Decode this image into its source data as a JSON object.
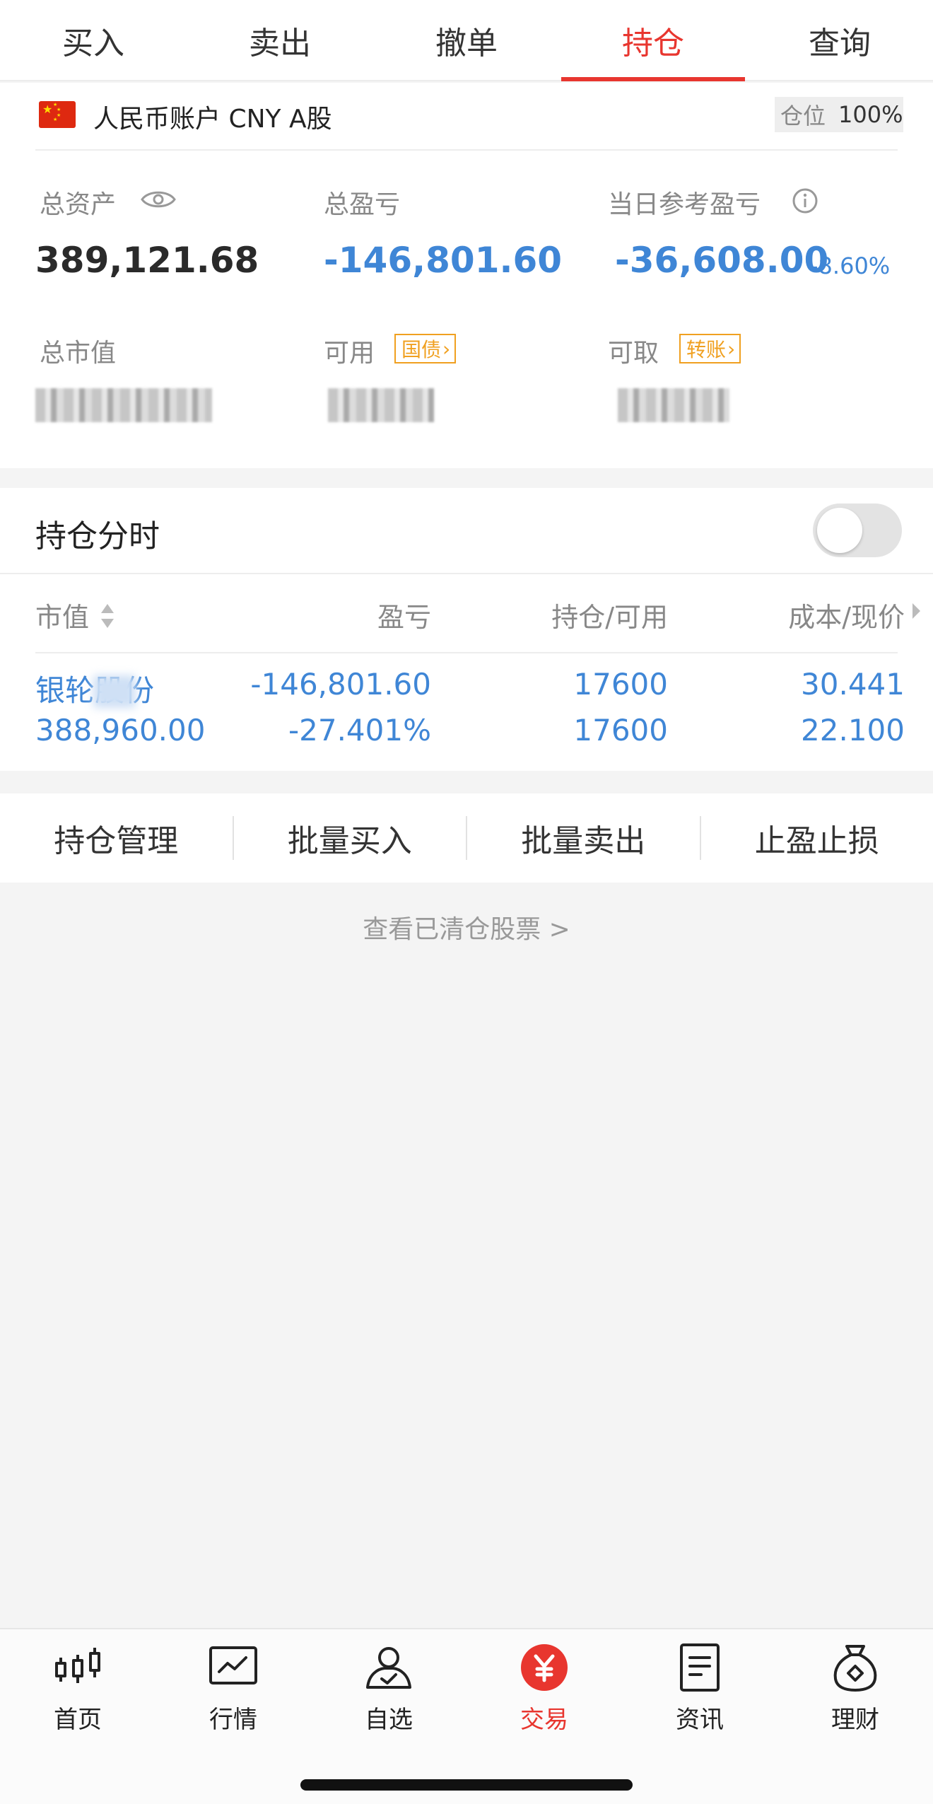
{
  "tabs": [
    {
      "label": "买入",
      "active": false
    },
    {
      "label": "卖出",
      "active": false
    },
    {
      "label": "撤单",
      "active": false
    },
    {
      "label": "持仓",
      "active": true
    },
    {
      "label": "查询",
      "active": false
    }
  ],
  "account": {
    "name": "人民币账户 CNY A股",
    "position_label": "仓位",
    "position_value": "100%",
    "total_assets_label": "总资产",
    "total_assets": "389,121.68",
    "total_pnl_label": "总盈亏",
    "total_pnl": "-146,801.60",
    "daily_pnl_label": "当日参考盈亏",
    "daily_pnl": "-36,608.00",
    "daily_pnl_pct": "-8.60%",
    "market_value_label": "总市值",
    "available_label": "可用",
    "available_tag": "国债",
    "withdrawable_label": "可取",
    "withdrawable_tag": "转账"
  },
  "holdings": {
    "title": "持仓分时",
    "toggle_on": false,
    "columns": [
      "市值",
      "盈亏",
      "持仓/可用",
      "成本/现价"
    ],
    "rows": [
      {
        "name": "银轮股份",
        "market_value": "388,960.00",
        "pnl": "-146,801.60",
        "pnl_pct": "-27.401%",
        "holding": "17600",
        "available": "17600",
        "cost": "30.441",
        "price": "22.100"
      }
    ]
  },
  "actions": [
    "持仓管理",
    "批量买入",
    "批量卖出",
    "止盈止损"
  ],
  "cleared_link": "查看已清仓股票 >",
  "bottom_nav": [
    {
      "label": "首页",
      "icon": "candlestick-icon",
      "active": false
    },
    {
      "label": "行情",
      "icon": "chart-icon",
      "active": false
    },
    {
      "label": "自选",
      "icon": "user-check-icon",
      "active": false
    },
    {
      "label": "交易",
      "icon": "yuan-icon",
      "active": true
    },
    {
      "label": "资讯",
      "icon": "document-icon",
      "active": false
    },
    {
      "label": "理财",
      "icon": "money-bag-icon",
      "active": false
    }
  ],
  "colors": {
    "accent_red": "#e8362f",
    "loss_blue": "#3f86d6",
    "tag_orange": "#f0a020"
  }
}
